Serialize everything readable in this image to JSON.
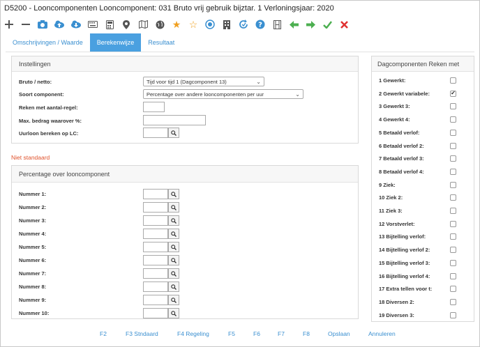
{
  "window": {
    "title": "D5200 - Looncomponenten Looncomponent: 031 Bruto vrij gebruik bijztar. 1 Verloningsjaar: 2020"
  },
  "toolbar": {
    "icons": [
      "plus-icon",
      "minus-icon",
      "camera-icon",
      "cloud-upload-icon",
      "cloud-download-icon",
      "keyboard-icon",
      "calculator-icon",
      "map-pin-icon",
      "map-icon",
      "globe-icon",
      "star-filled-icon",
      "star-outline-icon",
      "gauge-icon",
      "building-icon",
      "refresh-icon",
      "help-icon",
      "film-icon",
      "arrow-left-icon",
      "arrow-right-icon",
      "check-icon",
      "close-icon"
    ],
    "colors": {
      "dark": "#555555",
      "blue": "#3a8fd0",
      "orange": "#f0a020",
      "green": "#4caf50",
      "red": "#e03030"
    }
  },
  "tabs": [
    {
      "label": "Omschrijvingen / Waarde",
      "active": false
    },
    {
      "label": "Berekenwijze",
      "active": true
    },
    {
      "label": "Resultaat",
      "active": false
    }
  ],
  "instellingen": {
    "header": "Instellingen",
    "bruto_label": "Bruto / netto:",
    "bruto_value": "Tijd voor tijd 1 (Dagcomponent 13)",
    "soort_label": "Soort component:",
    "soort_value": "Percentage over andere looncomponenten per uur",
    "reken_label": "Reken met aantal-regel:",
    "max_label": "Max. bedrag waarover %:",
    "uurloon_label": "Uurloon bereken op LC:"
  },
  "status": {
    "niet_standaard": "Niet standaard"
  },
  "percentage": {
    "header": "Percentage over looncomponent",
    "rows": [
      "Nummer 1:",
      "Nummer 2:",
      "Nummer 3:",
      "Nummer 4:",
      "Nummer 5:",
      "Nummer 6:",
      "Nummer 7:",
      "Nummer 8:",
      "Nummer 9:",
      "Nummer 10:"
    ]
  },
  "dagcomponenten": {
    "header": "Dagcomponenten Reken met",
    "items": [
      {
        "label": "1 Gewerkt:",
        "checked": false
      },
      {
        "label": "2 Gewerkt variabele:",
        "checked": true
      },
      {
        "label": "3 Gewerkt 3:",
        "checked": false
      },
      {
        "label": "4 Gewerkt 4:",
        "checked": false
      },
      {
        "label": "5 Betaald verlof:",
        "checked": false
      },
      {
        "label": "6 Betaald verlof 2:",
        "checked": false
      },
      {
        "label": "7 Betaald verlof 3:",
        "checked": false
      },
      {
        "label": "8 Betaald verlof 4:",
        "checked": false
      },
      {
        "label": "9 Ziek:",
        "checked": false
      },
      {
        "label": "10 Ziek 2:",
        "checked": false
      },
      {
        "label": "11 Ziek 3:",
        "checked": false
      },
      {
        "label": "12 Vorstverlet:",
        "checked": false
      },
      {
        "label": "13 Bijtelling verlof:",
        "checked": false
      },
      {
        "label": "14 Bijtelling verlof 2:",
        "checked": false
      },
      {
        "label": "15 Bijtelling verlof 3:",
        "checked": false
      },
      {
        "label": "16 Bijtelling verlof 4:",
        "checked": false
      },
      {
        "label": "17 Extra tellen voor t:",
        "checked": false
      },
      {
        "label": "18 Diversen 2:",
        "checked": false
      },
      {
        "label": "19 Diversen 3:",
        "checked": false
      }
    ]
  },
  "footer": {
    "buttons": [
      "F2",
      "F3 Stndaard",
      "F4 Regeling",
      "F5",
      "F6",
      "F7",
      "F8",
      "Opslaan",
      "Annuleren"
    ]
  }
}
